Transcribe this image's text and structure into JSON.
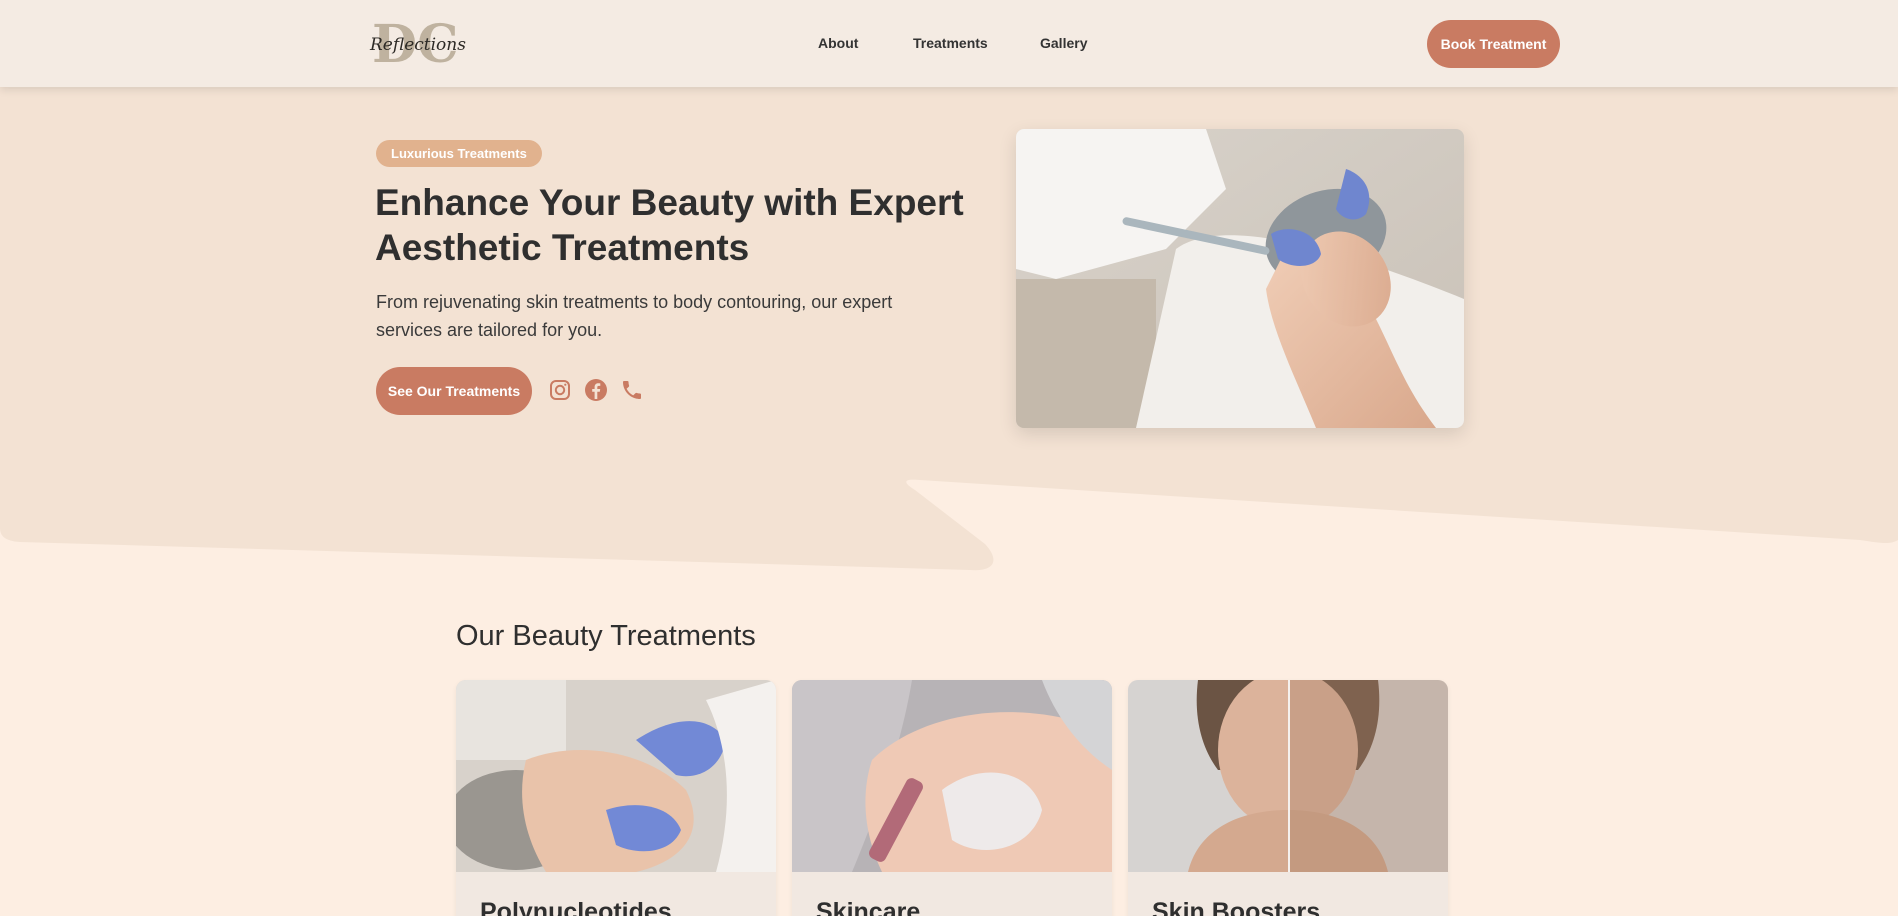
{
  "brand": {
    "logo_monogram": "DC",
    "logo_script": "Reflections"
  },
  "nav": {
    "items": [
      {
        "label": "About"
      },
      {
        "label": "Treatments"
      },
      {
        "label": "Gallery"
      }
    ],
    "book_label": "Book Treatment"
  },
  "hero": {
    "badge": "Luxurious Treatments",
    "title": "Enhance Your Beauty with Expert Aesthetic Treatments",
    "subtitle": "From rejuvenating skin treatments to body contouring, our expert services are tailored for you.",
    "cta_label": "See Our Treatments",
    "social_icons": [
      "instagram-icon",
      "facebook-icon",
      "phone-icon"
    ],
    "image": "woman-facial-treatment-photo"
  },
  "treatments": {
    "heading": "Our Beauty Treatments",
    "cards": [
      {
        "title": "Polynucleotides",
        "image": "neck-injection-photo"
      },
      {
        "title": "Skincare",
        "image": "microneedling-photo"
      },
      {
        "title": "Skin Boosters",
        "image": "before-after-face-photo"
      }
    ]
  },
  "colors": {
    "accent": "#c97b62",
    "badge": "#e1b28e",
    "header_bg": "#f4ebe3",
    "hero_bg": "#f3e2d3",
    "page_bg": "#fdeee2",
    "card_bg": "#f1e8e1"
  }
}
